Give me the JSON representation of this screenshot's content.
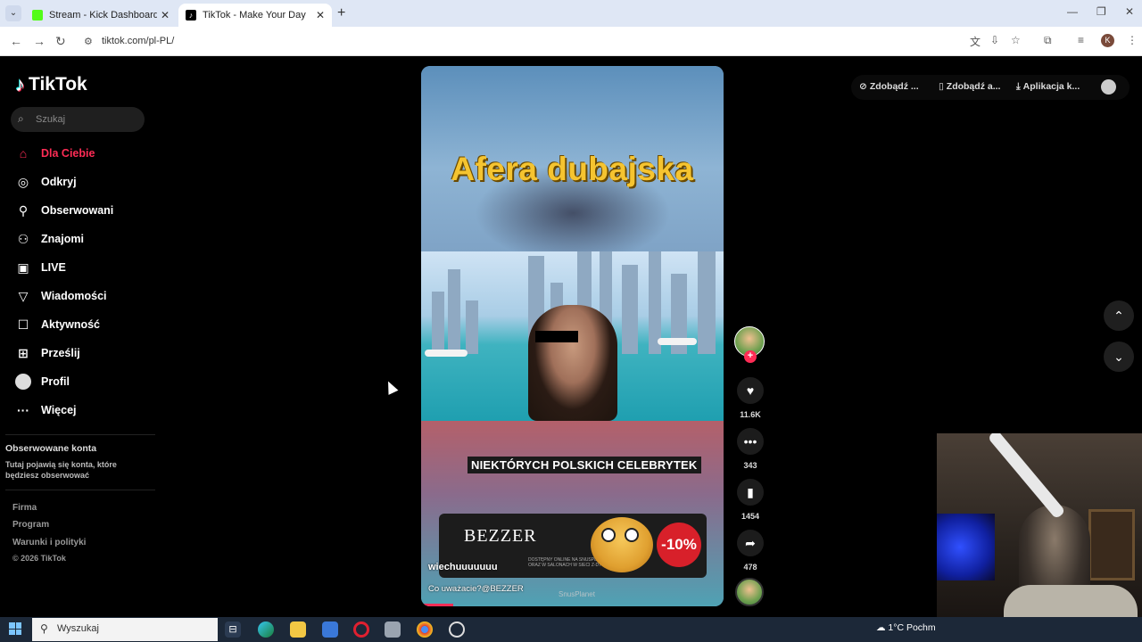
{
  "browser": {
    "tabs": [
      {
        "title": "Stream - Kick Dashboard"
      },
      {
        "title": "TikTok - Make Your Day"
      }
    ],
    "url": "tiktok.com/pl-PL/",
    "profile_initial": "K"
  },
  "sidebar": {
    "logo": "TikTok",
    "search_placeholder": "Szukaj",
    "items": [
      {
        "label": "Dla Ciebie",
        "icon": "home-icon",
        "active": true
      },
      {
        "label": "Odkryj",
        "icon": "compass-icon"
      },
      {
        "label": "Obserwowani",
        "icon": "user-follow-icon"
      },
      {
        "label": "Znajomi",
        "icon": "friends-icon"
      },
      {
        "label": "LIVE",
        "icon": "live-icon"
      },
      {
        "label": "Wiadomości",
        "icon": "send-icon"
      },
      {
        "label": "Aktywność",
        "icon": "inbox-icon"
      },
      {
        "label": "Prześlij",
        "icon": "upload-icon"
      },
      {
        "label": "Profil",
        "icon": "profile-avatar"
      },
      {
        "label": "Więcej",
        "icon": "more-icon"
      }
    ],
    "followed_title": "Obserwowane konta",
    "followed_sub": "Tutaj pojawią się konta, które będziesz obserwować",
    "footer": [
      "Firma",
      "Program",
      "Warunki i polityki",
      "© 2026 TikTok"
    ]
  },
  "top_actions": {
    "item1": "Zdobądź ...",
    "item2": "Zdobądź a...",
    "item3": "Aplikacja k..."
  },
  "video": {
    "title_overlay": "Afera dubajska",
    "caption_overlay": "NIEKTÓRYCH POLSKICH CELEBRYTEK",
    "ad_brand": "BEZZER",
    "ad_small": "DOSTĘPNY ONLINE NA SNUSPLANET.EU ORAZ W SALONACH W SIECI Z-DYM",
    "ad_badge": "-10%",
    "username": "wiechuuuuuuu",
    "description": "Co uważacie?@BEZZER",
    "music": "SnusPlanet"
  },
  "actions": {
    "likes": "11.6K",
    "comments": "343",
    "saves": "1454",
    "shares": "478"
  },
  "taskbar": {
    "search_placeholder": "Wyszukaj",
    "weather": "1°C  Pochm"
  },
  "colors": {
    "accent": "#fe2c55",
    "title_yellow": "#f5c430"
  }
}
